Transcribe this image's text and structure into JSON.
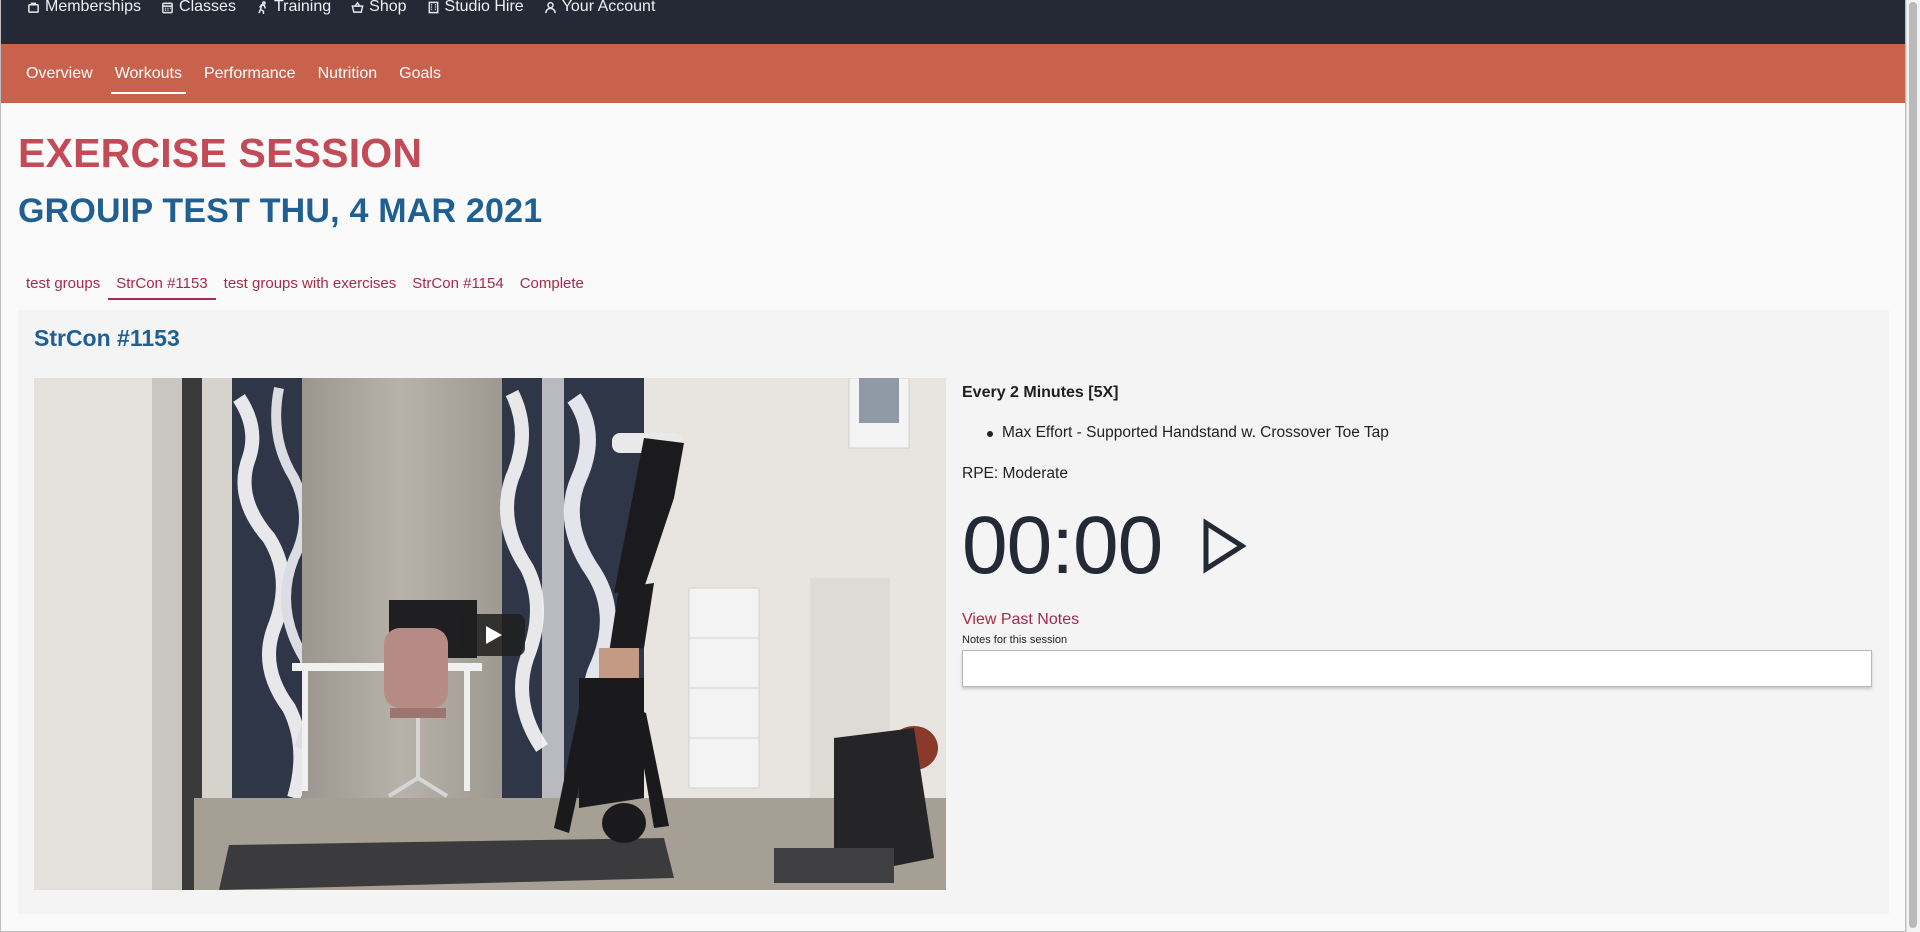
{
  "topnav": {
    "items": [
      {
        "label": "Memberships",
        "icon": "bag-icon"
      },
      {
        "label": "Classes",
        "icon": "calendar-icon"
      },
      {
        "label": "Training",
        "icon": "running-icon"
      },
      {
        "label": "Shop",
        "icon": "basket-icon"
      },
      {
        "label": "Studio Hire",
        "icon": "building-icon"
      },
      {
        "label": "Your Account",
        "icon": "user-icon"
      }
    ]
  },
  "subnav": {
    "items": [
      {
        "label": "Overview"
      },
      {
        "label": "Workouts",
        "active": true
      },
      {
        "label": "Performance"
      },
      {
        "label": "Nutrition"
      },
      {
        "label": "Goals"
      }
    ]
  },
  "page": {
    "title": "EXERCISE SESSION",
    "session_title": "GROUIP TEST THU, 4 MAR 2021"
  },
  "session_tabs": [
    {
      "label": "test groups"
    },
    {
      "label": "StrCon #1153",
      "active": true
    },
    {
      "label": "test groups with exercises"
    },
    {
      "label": "StrCon #1154"
    },
    {
      "label": "Complete"
    }
  ],
  "panel": {
    "title": "StrCon #1153",
    "interval": "Every 2 Minutes [5X]",
    "exercises": [
      "Max Effort - Supported Handstand w. Crossover Toe Tap"
    ],
    "rpe": "RPE: Moderate",
    "timer": "00:00",
    "past_notes_link": "View Past Notes",
    "notes_label": "Notes for this session",
    "notes_value": ""
  },
  "colors": {
    "topnav_bg": "#232a35",
    "subnav_bg": "#c9624c",
    "title_red": "#c24b57",
    "heading_blue": "#1f5f91",
    "link_crimson": "#a62a4a"
  }
}
